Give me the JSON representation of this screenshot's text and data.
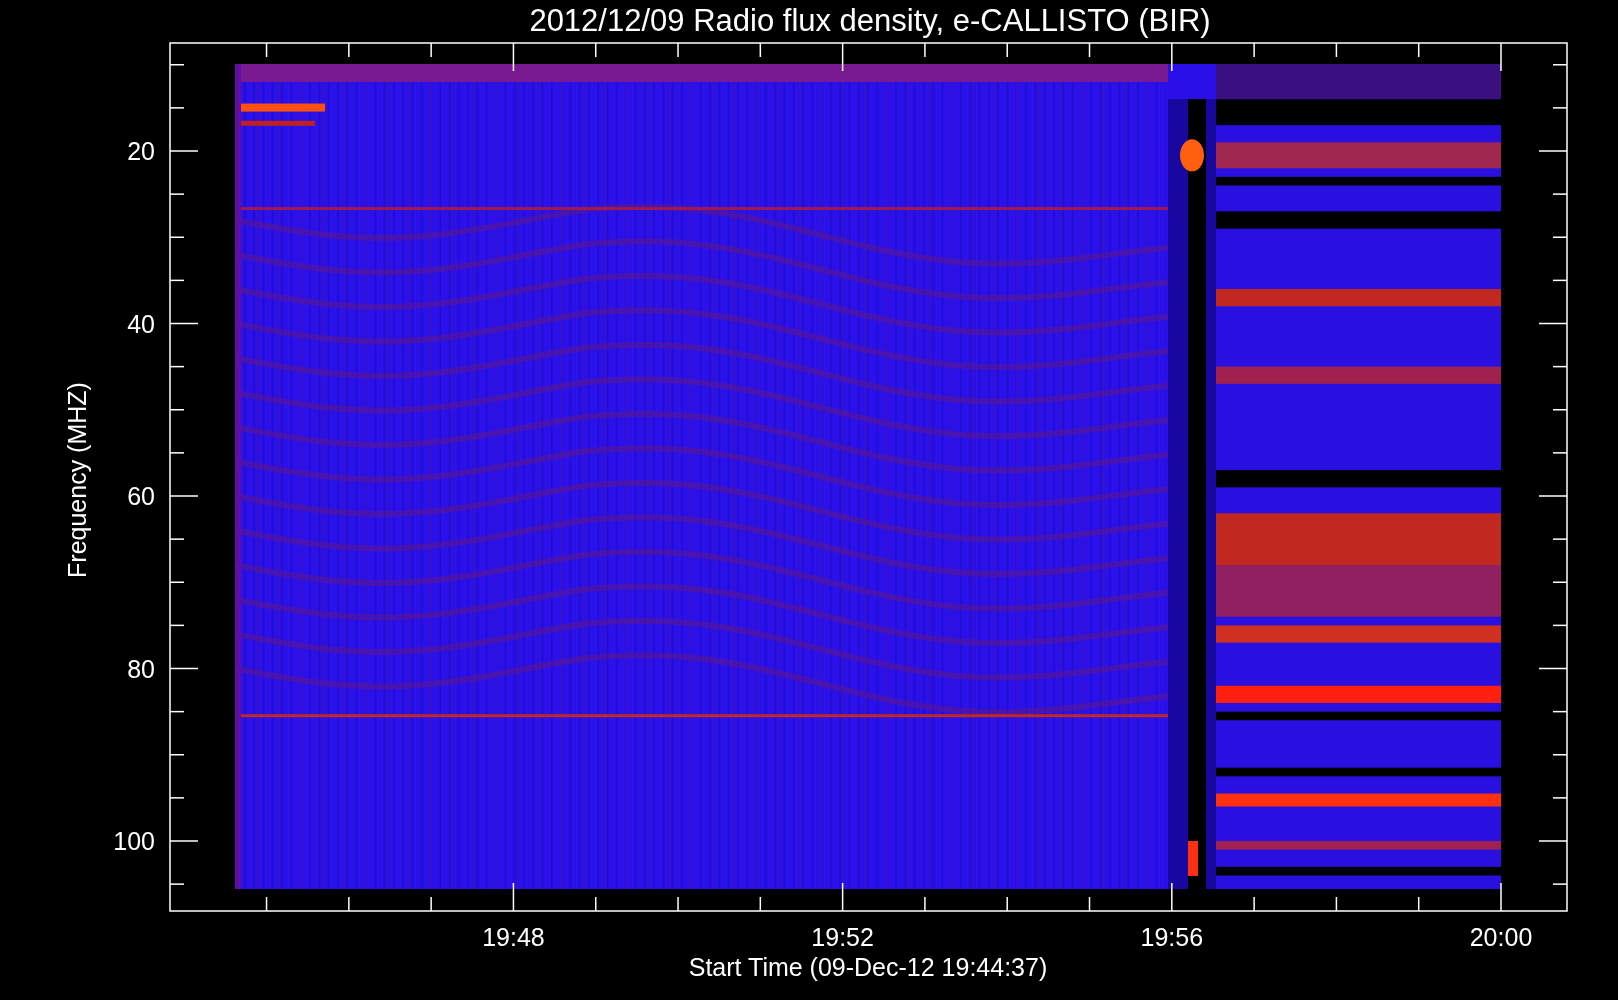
{
  "title": "2012/12/09  Radio flux density, e-CALLISTO (BIR)",
  "y_axis": {
    "title": "Frequency (MHZ)",
    "tick_labels": [
      "20",
      "40",
      "60",
      "80",
      "100"
    ]
  },
  "x_axis": {
    "title": "Start Time (09-Dec-12 19:44:37)",
    "tick_labels": [
      "19:48",
      "19:52",
      "19:56",
      "20:00"
    ]
  }
}
